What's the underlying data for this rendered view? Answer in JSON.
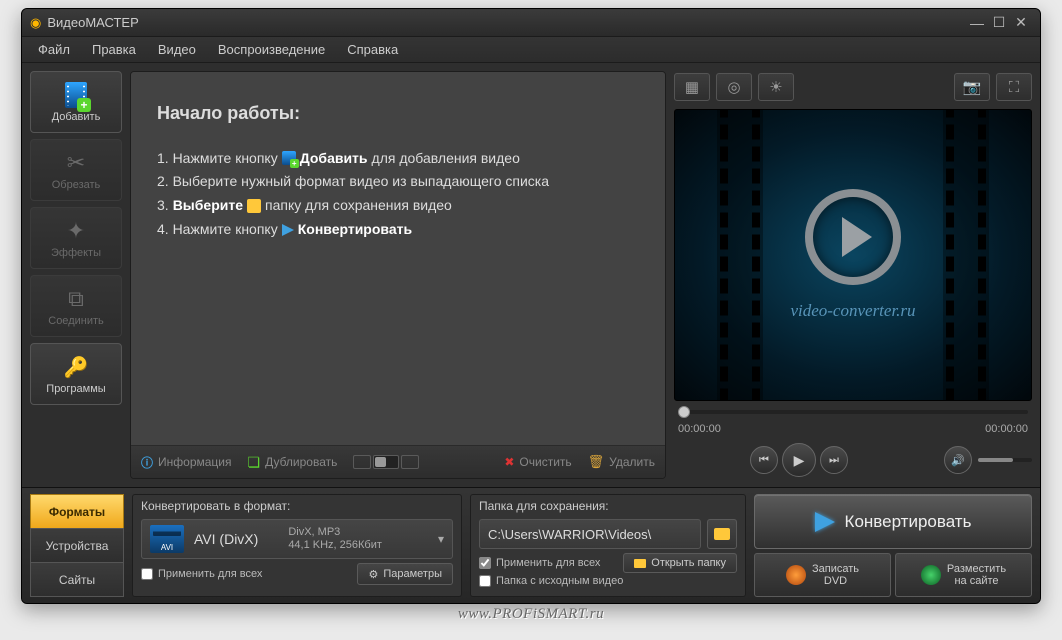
{
  "window": {
    "title": "ВидеоМАСТЕР"
  },
  "menu": [
    "Файл",
    "Правка",
    "Видео",
    "Воспроизведение",
    "Справка"
  ],
  "tools": {
    "add": "Добавить",
    "trim": "Обрезать",
    "effects": "Эффекты",
    "join": "Соединить",
    "programs": "Программы"
  },
  "start": {
    "heading": "Начало работы:",
    "step1a": "1. Нажмите кнопку ",
    "step1b": "Добавить",
    "step1c": " для добавления видео",
    "step2": "2. Выберите нужный формат видео из выпадающего списка",
    "step3a": "3. ",
    "step3b": "Выберите",
    "step3c": " папку для сохранения видео",
    "step4a": "4. Нажмите кнопку ",
    "step4b": "Конвертировать"
  },
  "list_toolbar": {
    "info": "Информация",
    "duplicate": "Дублировать",
    "clear": "Очистить",
    "delete": "Удалить"
  },
  "preview": {
    "caption": "video-converter.ru",
    "time_current": "00:00:00",
    "time_total": "00:00:00"
  },
  "format_tabs": {
    "formats": "Форматы",
    "devices": "Устройства",
    "sites": "Сайты"
  },
  "format_panel": {
    "title": "Конвертировать в формат:",
    "icon_label": "AVI",
    "name": "AVI (DivX)",
    "sub1": "DivX, MP3",
    "sub2": "44,1 KHz, 256Кбит",
    "apply_all": "Применить для всех",
    "params": "Параметры"
  },
  "save_panel": {
    "title": "Папка для сохранения:",
    "path": "C:\\Users\\WARRIOR\\Videos\\",
    "apply_all": "Применить для всех",
    "source_folder": "Папка с исходным видео",
    "open_folder": "Открыть папку"
  },
  "actions": {
    "convert": "Конвертировать",
    "burn1": "Записать",
    "burn2": "DVD",
    "publish1": "Разместить",
    "publish2": "на сайте"
  },
  "watermark": "www.PROFiSMART.ru"
}
